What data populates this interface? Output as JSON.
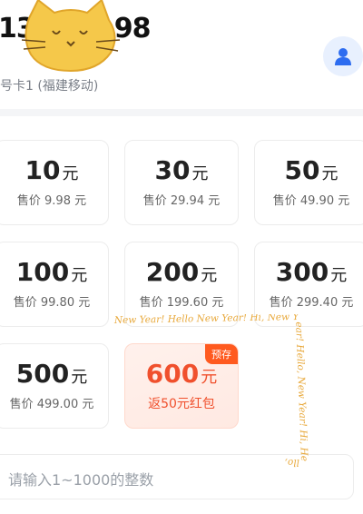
{
  "account": {
    "phone_start": "13",
    "phone_end": "98",
    "sim_label": "号卡1 (福建移动)"
  },
  "options": [
    {
      "amount": "10",
      "unit": "元",
      "price": "售价 9.98 元"
    },
    {
      "amount": "30",
      "unit": "元",
      "price": "售价 29.94 元"
    },
    {
      "amount": "50",
      "unit": "元",
      "price": "售价 49.90 元"
    },
    {
      "amount": "100",
      "unit": "元",
      "price": "售价 99.80 元"
    },
    {
      "amount": "200",
      "unit": "元",
      "price": "售价 199.60 元"
    },
    {
      "amount": "300",
      "unit": "元",
      "price": "售价 299.40 元"
    },
    {
      "amount": "500",
      "unit": "元",
      "price": "售价 499.00 元"
    },
    {
      "amount": "600",
      "unit": "元",
      "price": "返50元红包",
      "badge": "预存"
    }
  ],
  "custom_input": {
    "placeholder": "请输入1~1000的整数"
  },
  "overlay": {
    "stamp_text": "New Year! Hello New Year! Hi, New Year! Hello, New Year! Hi, Hello,"
  },
  "colors": {
    "accent": "#f0502d",
    "badge": "#ff5a1f",
    "avatar_blue": "#2d6cf0"
  },
  "icons": {
    "avatar": "user-icon",
    "sticker": "cat-sticker-icon"
  }
}
